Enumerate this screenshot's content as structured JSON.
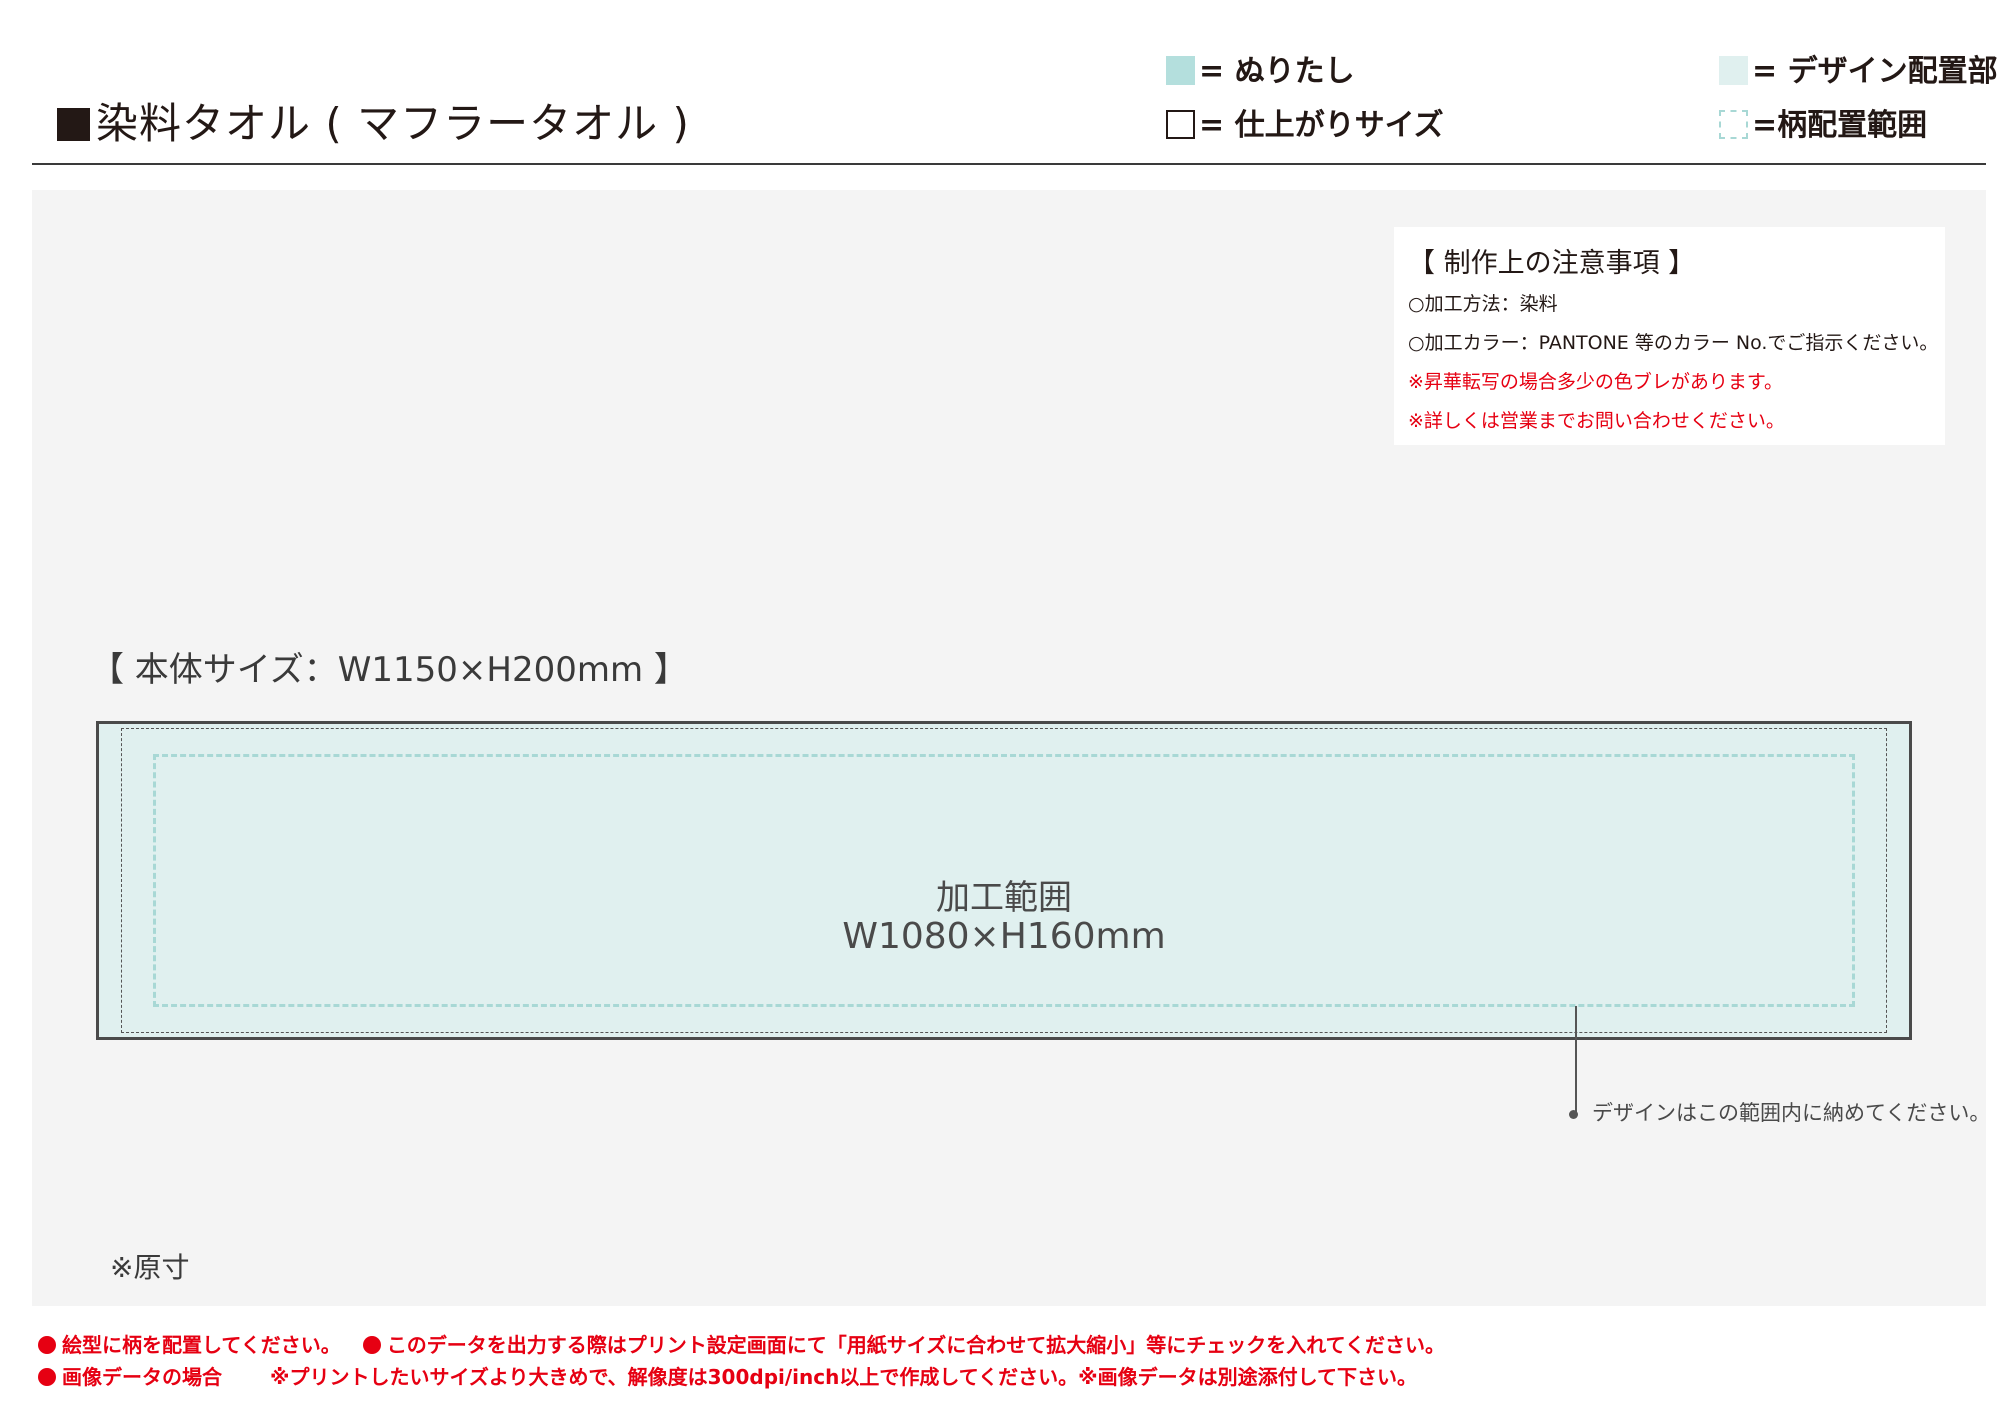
{
  "header": {
    "title": "染料タオル ( マフラータオル )"
  },
  "legend": {
    "bleed": "= ぬりたし",
    "trim_size": "= 仕上がりサイズ",
    "design_area": "= デザイン配置部",
    "pattern_area": "=柄配置範囲",
    "colors": {
      "bleed": "#b4dfdd",
      "design_area": "#e0f0ef",
      "pattern_border": "#a8d8d5"
    }
  },
  "notes": {
    "title": "【 制作上の注意事項 】",
    "lines": [
      "○加工方法：染料",
      "○加工カラー：PANTONE 等のカラー No.でご指示ください。"
    ],
    "warnings": [
      "※昇華転写の場合多少の色ブレがあります。",
      "※詳しくは営業までお問い合わせください。"
    ],
    "warning_color": "#e60012"
  },
  "template": {
    "body_size_label": "【 本体サイズ：W1150×H200mm 】",
    "area_label": "加工範囲",
    "area_size": "W1080×H160mm",
    "leader_note": "デザインはこの範囲内に納めてください。",
    "scale_note": "※原寸"
  },
  "footer": {
    "line1": "絵型に柄を配置してください。",
    "line1b": "このデータを出力する際はプリント設定画面にて「用紙サイズに合わせて拡大縮小」等にチェックを入れてください。",
    "line2": "画像データの場合",
    "line2b": "※プリントしたいサイズより大きめで、解像度は300dpi/inch以上で作成してください。※画像データは別途添付して下さい。",
    "color": "#e60012"
  }
}
